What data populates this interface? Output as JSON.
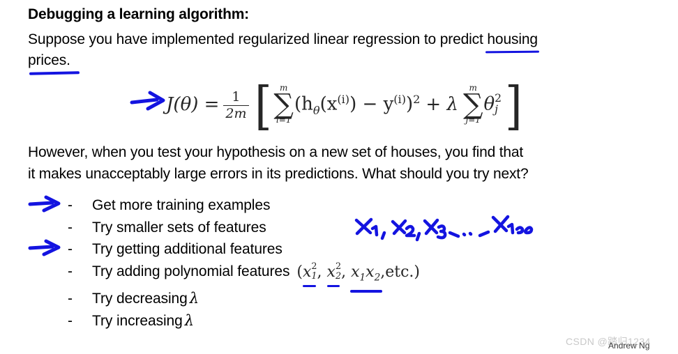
{
  "slide": {
    "title": "Debugging a learning algorithm:",
    "intro": {
      "before_housing": "Suppose you have implemented regularized linear regression to predict ",
      "housing": "housing",
      "after_housing": "prices."
    },
    "formula": {
      "lhs": "J(θ) =",
      "frac_num": "1",
      "frac_den": "2m",
      "sum1_upper": "m",
      "sum1_lower": "i=1",
      "sum1_body": "(h",
      "sum1_theta": "θ",
      "sum1_x": "(x",
      "sum1_xsup": "(i)",
      "sum1_close": ") − y",
      "sum1_ysup": "(i)",
      "sum1_sq": ")",
      "sum1_sqsup": "2",
      "plus_lambda": "+ λ",
      "sum2_upper": "m",
      "sum2_lower": "j=1",
      "sum2_body": "θ",
      "sum2_sub": "j",
      "sum2_sup": "2",
      "latex": "J(θ) = 1/(2m) [ Σ_{i=1}^{m} (h_θ(x^(i)) − y^(i))^2 + λ Σ_{j=1}^{m} θ_j^2 ]"
    },
    "paragraph2_line1": "However, when you test your hypothesis on a new set of houses, you find that",
    "paragraph2_line2": "it makes unacceptably large errors in its predictions. What should you try next?",
    "bullet_marker": "-",
    "bullets": [
      {
        "text": "Get more training examples",
        "has_arrow": true
      },
      {
        "text": "Try smaller sets of features",
        "has_arrow": false
      },
      {
        "text": "Try getting additional features",
        "has_arrow": true
      },
      {
        "text": "Try adding polynomial features",
        "has_arrow": false
      },
      {
        "text": "Try decreasing",
        "lambda": "λ",
        "has_arrow": false
      },
      {
        "text": "Try increasing",
        "lambda": "λ",
        "has_arrow": false
      }
    ],
    "poly_math": {
      "open": "(",
      "term1_base": "x",
      "term1_sub": "1",
      "term1_sup": "2",
      "comma1": ", ",
      "term2_base": "x",
      "term2_sub": "2",
      "term2_sup": "2",
      "comma2": ", ",
      "term3_a_base": "x",
      "term3_a_sub": "1",
      "term3_b_base": "x",
      "term3_b_sub": "2",
      "etc": ",etc.",
      "close": ")"
    },
    "handwritten_note": "x₁ , x₂, x₃, .. , x₁₀₀",
    "watermark": "CSDN @踏归1234",
    "presenter": "Andrew Ng",
    "colors": {
      "ink_blue": "#1414e0",
      "text_black": "#000000",
      "math_gray": "#262626",
      "watermark_gray": "#c9c9c9"
    }
  }
}
